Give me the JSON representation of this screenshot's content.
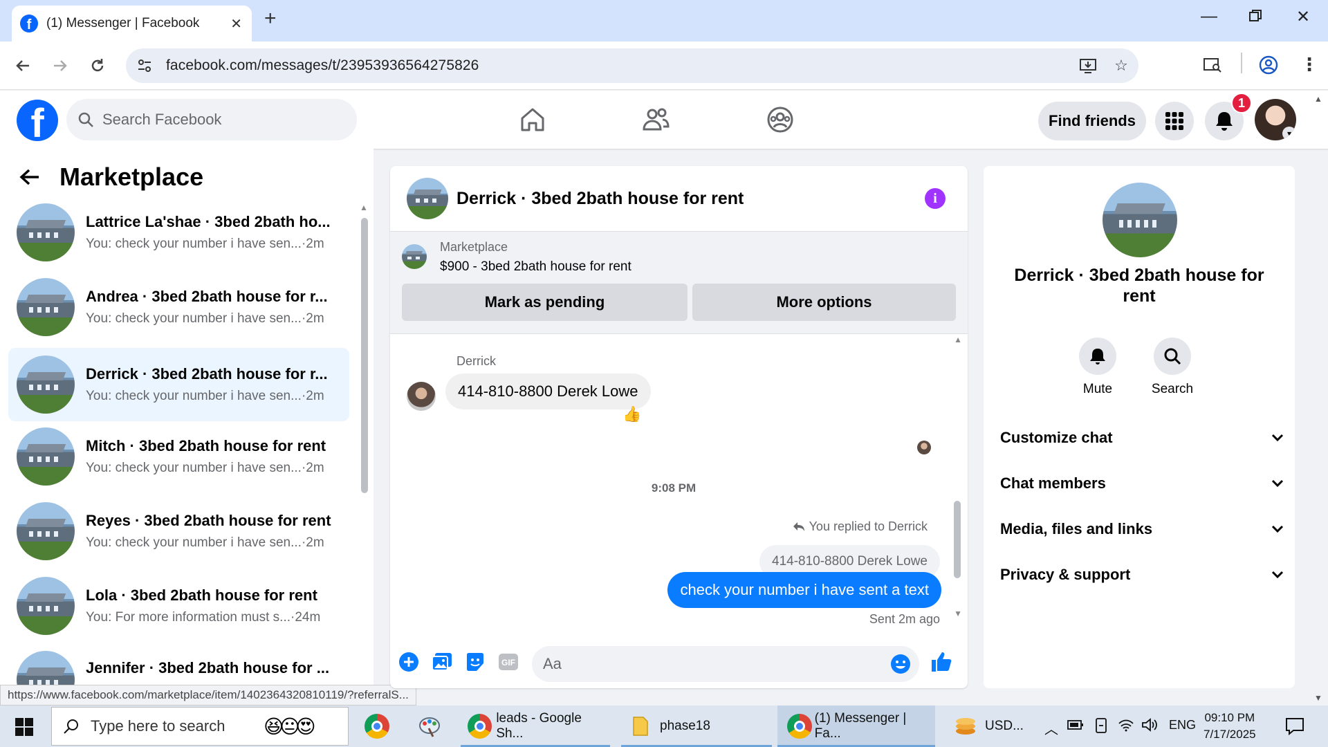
{
  "browser": {
    "tab_title": "(1) Messenger | Facebook",
    "tab_favicon": "f",
    "url": "facebook.com/messages/t/23953936564275826",
    "status_url": "https://www.facebook.com/marketplace/item/1402364320810119/?referralS..."
  },
  "header": {
    "logo_letter": "f",
    "search_placeholder": "Search Facebook",
    "find_friends": "Find friends",
    "notification_count": "1"
  },
  "sidebar": {
    "title": "Marketplace",
    "conversations": [
      {
        "name": "Lattrice La'shae · 3bed 2bath ho...",
        "preview": "You: check your number i have sen...",
        "time": "·2m"
      },
      {
        "name": "Andrea · 3bed 2bath house for r...",
        "preview": "You: check your number i have sen...",
        "time": "·2m"
      },
      {
        "name": "Derrick · 3bed 2bath house for r...",
        "preview": "You: check your number i have sen...",
        "time": "·2m"
      },
      {
        "name": "Mitch · 3bed 2bath house for rent",
        "preview": "You: check your number i have sen...",
        "time": "·2m"
      },
      {
        "name": "Reyes · 3bed 2bath house for rent",
        "preview": "You: check your number i have sen...",
        "time": "·2m"
      },
      {
        "name": "Lola · 3bed 2bath house for rent",
        "preview": "You: For more information must s...",
        "time": "·24m"
      },
      {
        "name": "Jennifer · 3bed 2bath house for ...",
        "preview": "",
        "time": ""
      }
    ]
  },
  "chat": {
    "title": "Derrick · 3bed 2bath house for rent",
    "marketplace_label": "Marketplace",
    "listing": "$900 - 3bed 2bath house for rent",
    "mark_pending": "Mark as pending",
    "more_options": "More options",
    "sender_name": "Derrick",
    "incoming_message": "414-810-8800 Derek Lowe",
    "reaction": "👍",
    "timestamp": "9:08 PM",
    "replied_label": "You replied to Derrick",
    "quoted_message": "414-810-8800 Derek Lowe",
    "outgoing_message": "check your number i have sent a text",
    "sent_status": "Sent 2m ago",
    "composer_placeholder": "Aa"
  },
  "details": {
    "name": "Derrick · 3bed 2bath house for rent",
    "mute": "Mute",
    "search": "Search",
    "sections": [
      "Customize chat",
      "Chat members",
      "Media, files and links",
      "Privacy & support"
    ]
  },
  "taskbar": {
    "search_placeholder": "Type here to search",
    "apps": [
      "leads - Google Sh...",
      "phase18",
      "(1) Messenger | Fa...",
      "USD..."
    ],
    "language": "ENG",
    "time": "09:10 PM",
    "date": "7/17/2025"
  },
  "colors": {
    "facebook_blue": "#0866ff",
    "messenger_bubble": "#0a7cff",
    "info_purple": "#a033ff",
    "badge_red": "#e41e3f"
  }
}
